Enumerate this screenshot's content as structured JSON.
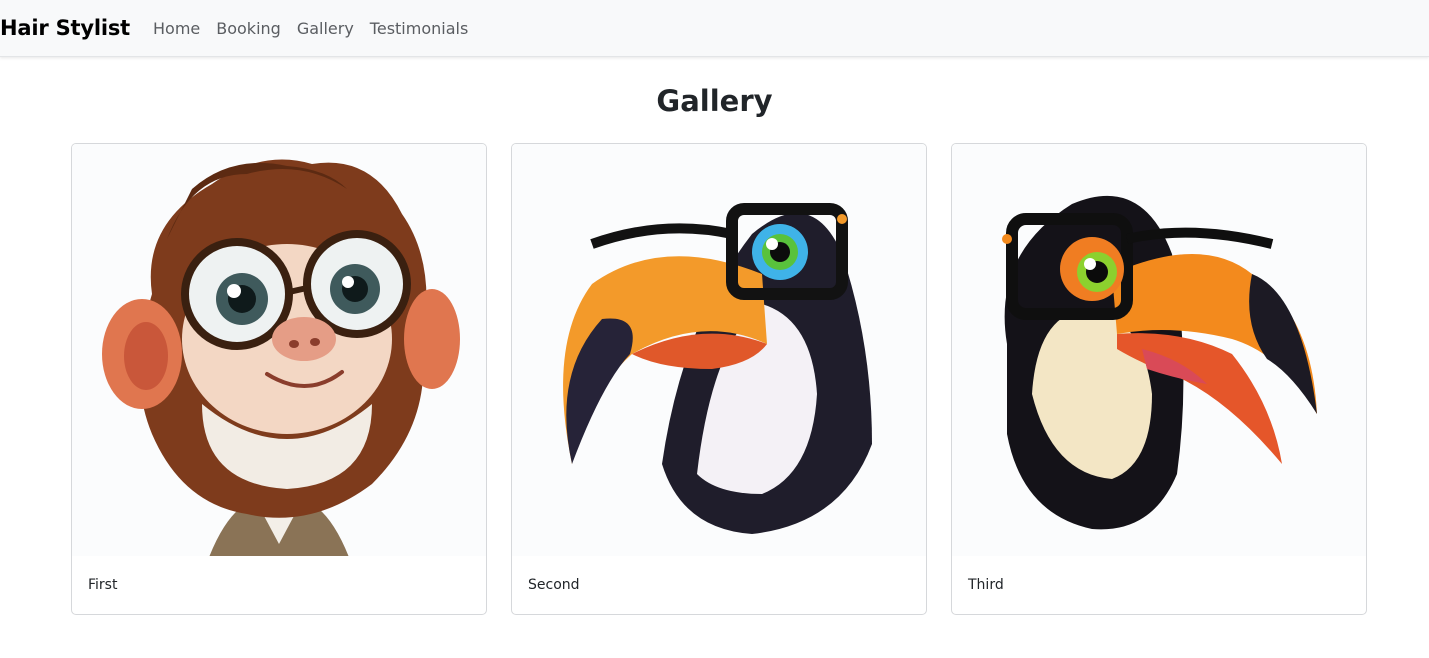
{
  "navbar": {
    "brand": "Hair Stylist",
    "links": [
      {
        "label": "Home"
      },
      {
        "label": "Booking"
      },
      {
        "label": "Gallery"
      },
      {
        "label": "Testimonials"
      }
    ]
  },
  "page": {
    "title": "Gallery"
  },
  "gallery": {
    "items": [
      {
        "caption": "First",
        "image": "monkey-with-glasses-illustration"
      },
      {
        "caption": "Second",
        "image": "toucan-with-glasses-illustration"
      },
      {
        "caption": "Third",
        "image": "toucan-with-glasses-illustration"
      }
    ]
  },
  "colors": {
    "navbar_bg": "#f8f9fa",
    "card_border": "#d6d8db",
    "text": "#212529",
    "nav_link": "#5a5d61"
  }
}
